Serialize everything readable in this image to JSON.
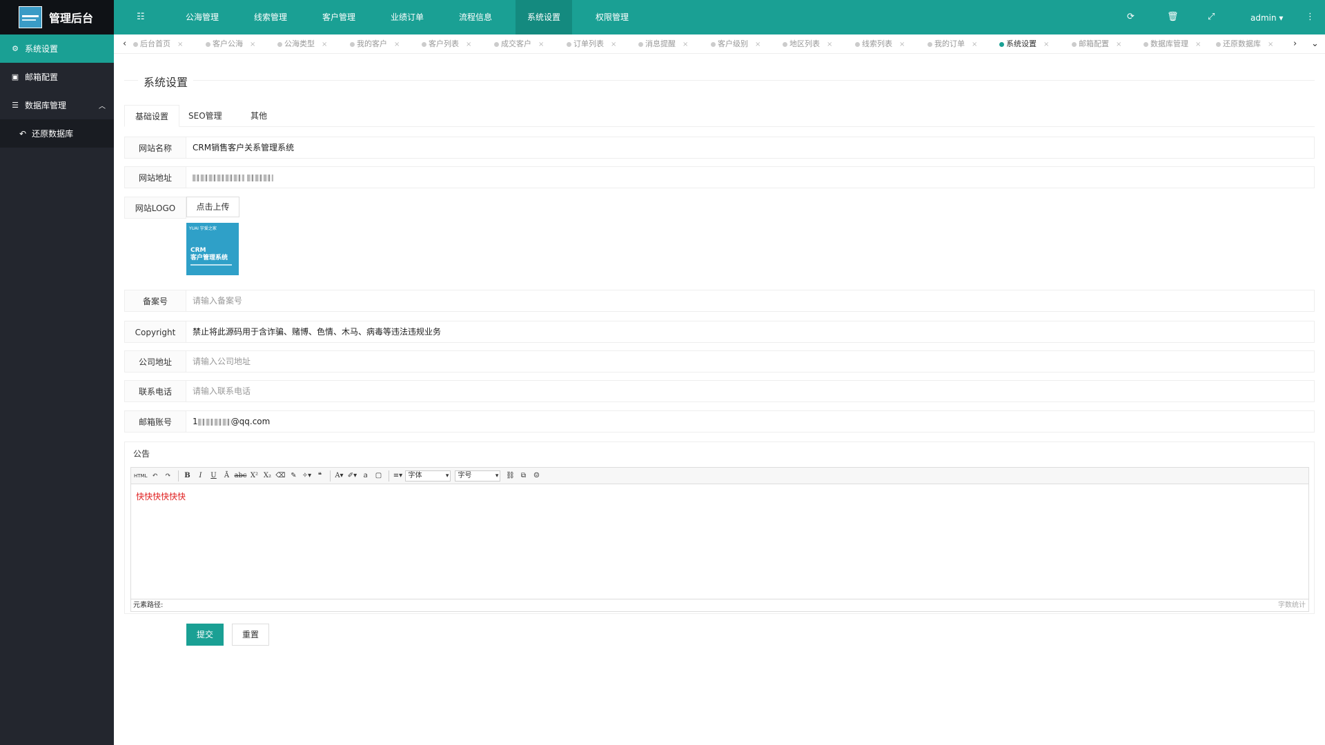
{
  "app": {
    "title": "管理后台"
  },
  "sidebar": {
    "items": [
      {
        "label": "系统设置",
        "icon": "gears-icon",
        "active": true
      },
      {
        "label": "邮箱配置",
        "icon": "window-icon"
      },
      {
        "label": "数据库管理",
        "icon": "database-icon",
        "expanded": true
      }
    ],
    "sub_items": [
      {
        "label": "还原数据库",
        "icon": "undo-icon"
      }
    ]
  },
  "header": {
    "nav": [
      "公海管理",
      "线索管理",
      "客户管理",
      "业绩订单",
      "流程信息",
      "系统设置",
      "权限管理"
    ],
    "active_nav": "系统设置",
    "user": "admin",
    "icons": [
      "menu-toggle-icon",
      "refresh-icon",
      "trash-icon",
      "fullscreen-icon",
      "more-icon"
    ]
  },
  "tabs": [
    "后台首页",
    "客户公海",
    "公海类型",
    "我的客户",
    "客户列表",
    "成交客户",
    "订单列表",
    "消息提醒",
    "客户级别",
    "地区列表",
    "线索列表",
    "我的订单",
    "系统设置",
    "邮箱配置",
    "数据库管理",
    "还原数据库"
  ],
  "active_tab": "系统设置",
  "page": {
    "title": "系统设置",
    "subtabs": [
      "基础设置",
      "SEO管理",
      "其他"
    ],
    "form": {
      "site_name_label": "网站名称",
      "site_name_value": "CRM销售客户关系管理系统",
      "site_url_label": "网站地址",
      "site_logo_label": "网站LOGO",
      "upload_label": "点击上传",
      "logo_preview": {
        "brand": "YUAI 宇爱之家",
        "line1": "CRM",
        "line2": "客户管理系统"
      },
      "icp_label": "备案号",
      "icp_placeholder": "请输入备案号",
      "copyright_label": "Copyright",
      "copyright_value": "禁止将此源码用于含诈骗、赌博、色情、木马、病毒等违法违规业务",
      "address_label": "公司地址",
      "address_placeholder": "请输入公司地址",
      "phone_label": "联系电话",
      "phone_placeholder": "请输入联系电话",
      "email_label": "邮箱账号",
      "email_prefix": "1",
      "email_suffix": "@qq.com",
      "notice_label": "公告",
      "editor": {
        "font_select": "字体",
        "size_select": "字号",
        "content": "快快快快快快",
        "path_label": "元素路径:",
        "word_count_label": "字数统计",
        "html_button": "HTML"
      },
      "submit_label": "提交",
      "reset_label": "重置"
    }
  },
  "colors": {
    "accent": "#1aa094",
    "sidebar": "#23262e",
    "logo_bar": "#0f1216",
    "editor_text": "#e02020"
  }
}
